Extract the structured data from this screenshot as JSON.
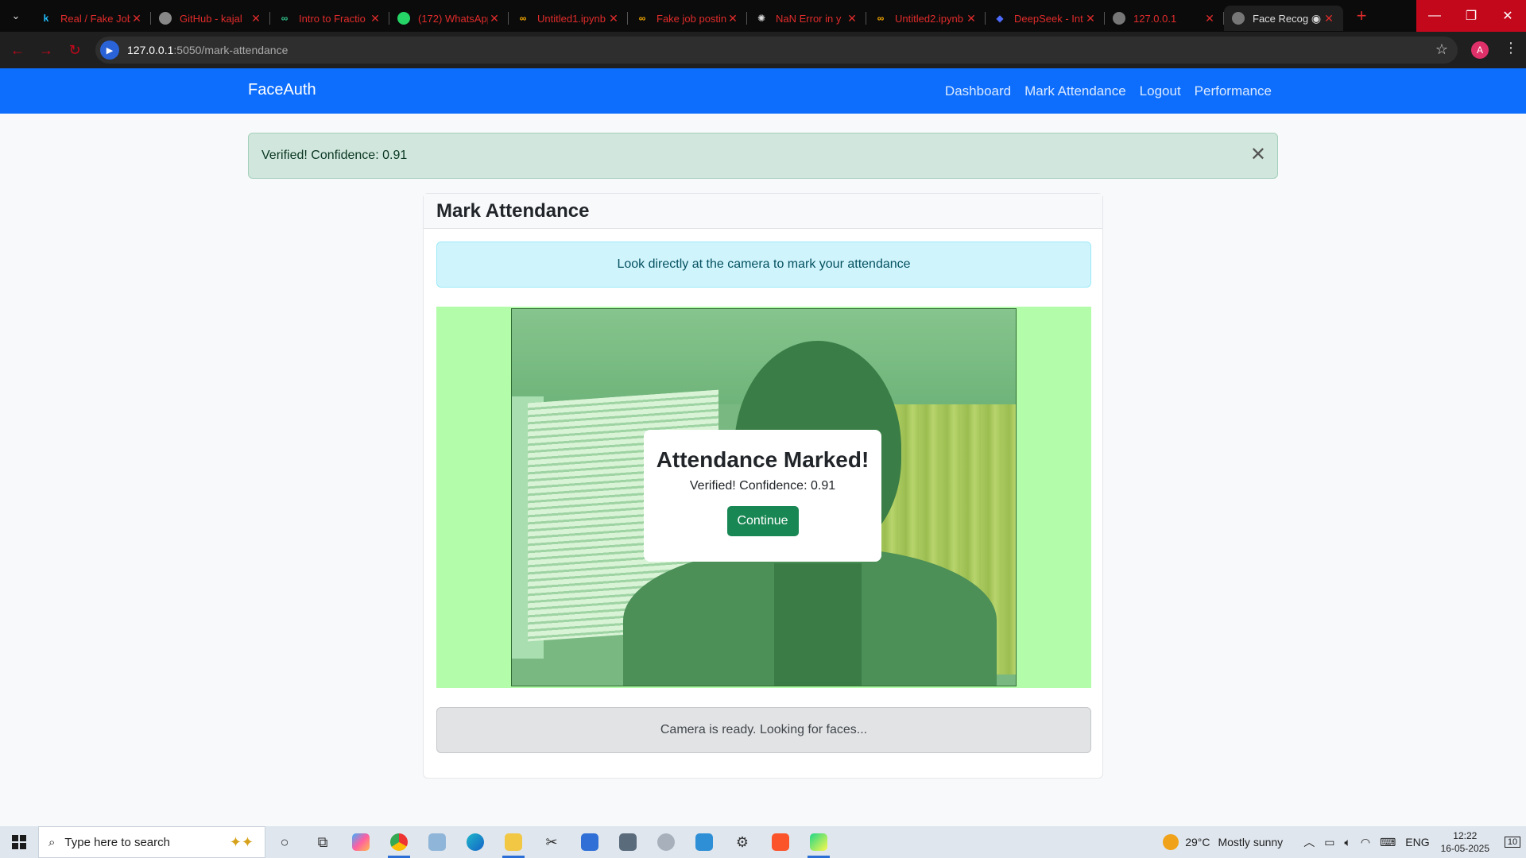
{
  "browser": {
    "tabs": [
      {
        "title": "Real / Fake Job",
        "favicon": "k"
      },
      {
        "title": "GitHub - kajal",
        "favicon": "github-icon"
      },
      {
        "title": "Intro to Fractio",
        "favicon": "link-icon"
      },
      {
        "title": "(172) WhatsApp",
        "favicon": "whatsapp-icon"
      },
      {
        "title": "Untitled1.ipynb",
        "favicon": "colab-icon"
      },
      {
        "title": "Fake job postin",
        "favicon": "colab-icon"
      },
      {
        "title": "NaN Error in y",
        "favicon": "openai-icon"
      },
      {
        "title": "Untitled2.ipynb",
        "favicon": "colab-icon"
      },
      {
        "title": "DeepSeek - Int",
        "favicon": "deepseek-icon"
      },
      {
        "title": "127.0.0.1",
        "favicon": "globe-icon"
      },
      {
        "title": "Face Recog",
        "favicon": "globe-icon"
      }
    ],
    "active_tab": 10,
    "url_host": "127.0.0.1",
    "url_path": ":5050/mark-attendance",
    "profile_initial": "A",
    "accent": "#c4081c"
  },
  "app": {
    "brand": "FaceAuth",
    "nav": [
      "Dashboard",
      "Mark Attendance",
      "Logout",
      "Performance"
    ],
    "navbar_color": "#0d6efd",
    "flash": "Verified! Confidence: 0.91",
    "card_title": "Mark Attendance",
    "instruction": "Look directly at the camera to mark your attendance",
    "camera_overlay_color": "#b3fca9",
    "modal": {
      "title": "Attendance Marked!",
      "message": "Verified! Confidence: 0.91",
      "button": "Continue"
    },
    "status": "Camera is ready. Looking for faces..."
  },
  "taskbar": {
    "search_placeholder": "Type here to search",
    "weather": "29°C",
    "weather_desc": "Mostly sunny",
    "lang": "ENG",
    "time": "12:22",
    "date": "16-05-2025",
    "notifications": "10"
  }
}
